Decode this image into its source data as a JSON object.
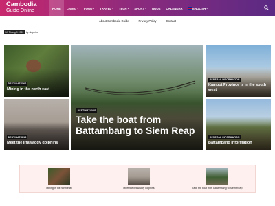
{
  "site": {
    "logo_line1": "Cambodia",
    "logo_line2": "Guide Online"
  },
  "nav": {
    "items": [
      {
        "label": "HOME",
        "has_dropdown": false,
        "active": true
      },
      {
        "label": "LIVING",
        "has_dropdown": true
      },
      {
        "label": "FOOD",
        "has_dropdown": true
      },
      {
        "label": "TRAVEL",
        "has_dropdown": true
      },
      {
        "label": "TECH",
        "has_dropdown": true
      },
      {
        "label": "SPORT",
        "has_dropdown": true
      },
      {
        "label": "NGOS",
        "has_dropdown": false
      },
      {
        "label": "CALENDAR",
        "has_dropdown": false
      },
      {
        "label": "ENGLISH",
        "has_dropdown": true,
        "icon": "flag-icon"
      }
    ],
    "chevron": "▾",
    "search_icon": "search-icon"
  },
  "submenu": {
    "items": [
      "About Cambodia Guide",
      "Privacy Policy",
      "Contact"
    ]
  },
  "date_bar": {
    "date": "17 Tháng 9 2022",
    "author": "by dolphins"
  },
  "tiles": [
    {
      "category": "DESTINATIONS",
      "title": "Mining in the north east"
    },
    {
      "category": "DESTINATIONS",
      "title": "Meet the Irrawaddy dolphins"
    },
    {
      "category": "DESTINATIONS",
      "title": "Take the boat from Battambang to Siem Reap"
    },
    {
      "category": "GENERAL INFORMATION",
      "title": "Kampot Province is in the south west"
    },
    {
      "category": "GENERAL INFORMATION",
      "title": "Battambang information"
    }
  ],
  "related": [
    {
      "caption": "Mining in the north east"
    },
    {
      "caption": "Meet the Irrawaddy dolphins"
    },
    {
      "caption": "Take the boat from Battambang to Siem Reap"
    }
  ],
  "colors": {
    "nav_gradient_start": "#c8286e",
    "nav_gradient_end": "#5a2a84",
    "strip_bg": "#fdf0ee"
  }
}
